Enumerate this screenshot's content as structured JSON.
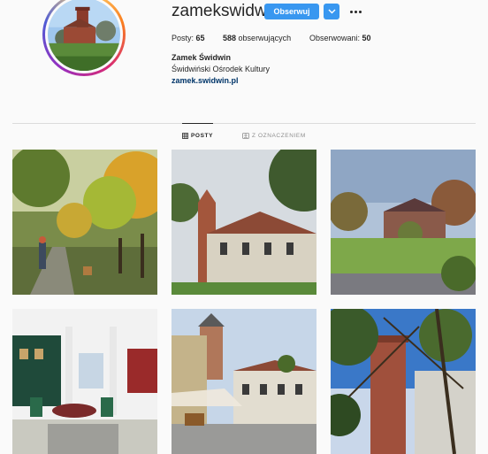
{
  "profile": {
    "username": "zamekswidwin",
    "follow_label": "Obserwuj",
    "full_name": "Zamek Świdwin",
    "category": "Świdwiński Ośrodek Kultury",
    "website": "zamek.swidwin.pl"
  },
  "stats": {
    "posts_label": "Posty:",
    "posts_value": "65",
    "followers_value": "588",
    "followers_label": "obserwujących",
    "following_label": "Obserwowani:",
    "following_value": "50"
  },
  "tabs": {
    "posts": "POSTY",
    "tagged": "Z OZNACZENIEM"
  },
  "grid": {
    "posts": [
      {
        "alt": "autumn park alley"
      },
      {
        "alt": "brick castle facade"
      },
      {
        "alt": "castle across park"
      },
      {
        "alt": "castle interior room"
      },
      {
        "alt": "castle courtyard"
      },
      {
        "alt": "castle tower with trees"
      }
    ]
  },
  "colors": {
    "accent": "#3897f0",
    "link": "#003569",
    "muted": "#8e8e8e"
  },
  "icons": [
    "chevron-down-icon",
    "more-icon",
    "grid-icon",
    "tagged-icon"
  ]
}
